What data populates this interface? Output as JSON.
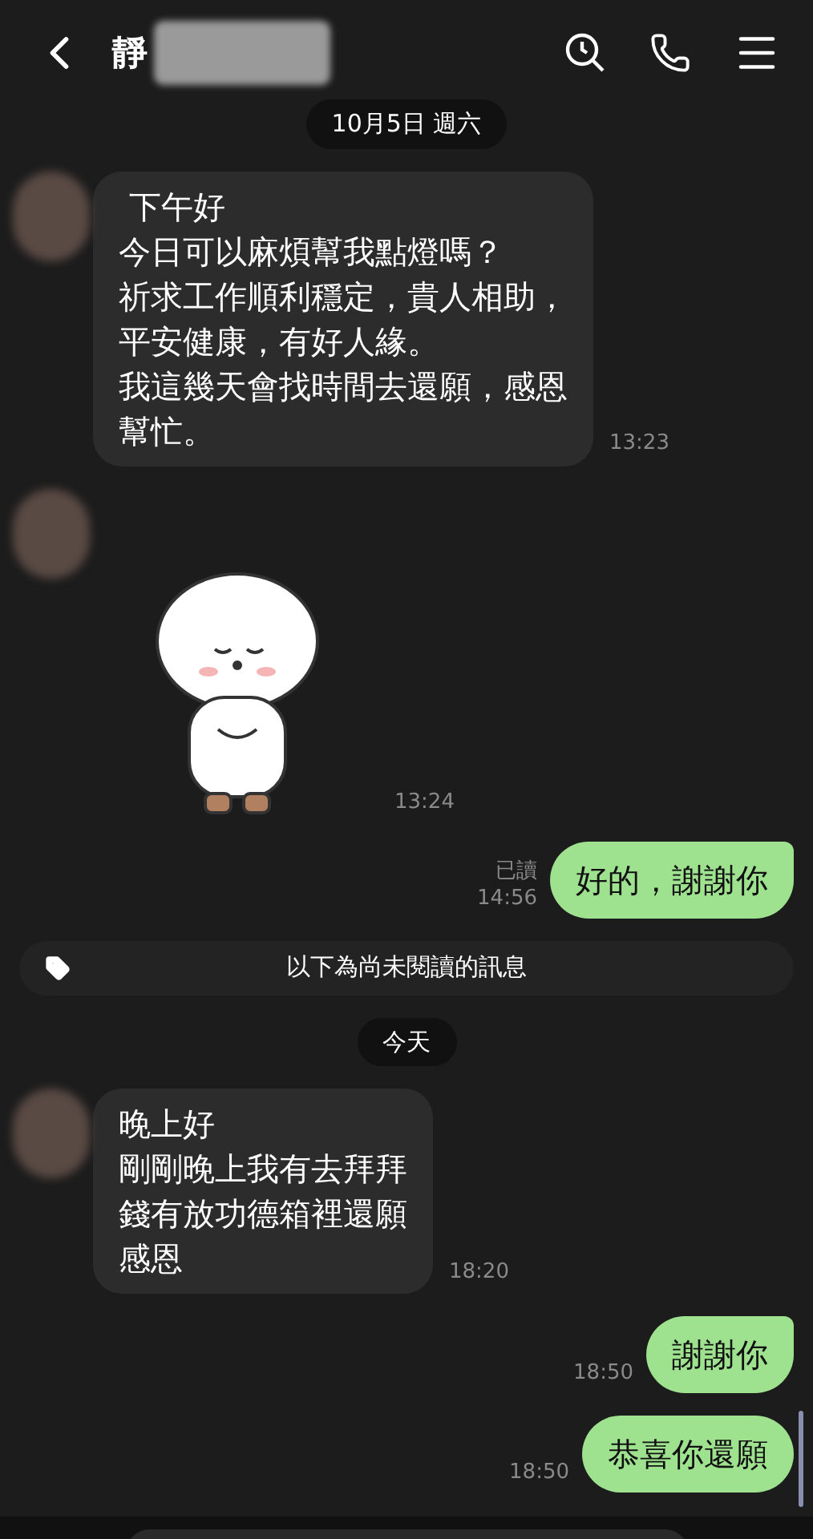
{
  "header": {
    "title": "靜",
    "name_redacted": true
  },
  "messages": [
    {
      "kind": "date",
      "text": "10月5日 週六"
    },
    {
      "kind": "incoming",
      "lines": [
        " 下午好",
        "今日可以麻煩幫我點燈嗎？",
        "祈求工作順利穩定，貴人相助，",
        "平安健康，有好人緣。",
        "我這幾天會找時間去還願，感恩",
        "幫忙。"
      ],
      "time": "13:23"
    },
    {
      "kind": "sticker",
      "time": "13:24"
    },
    {
      "kind": "outgoing",
      "text": "好的，謝謝你",
      "read": "已讀",
      "time": "14:56",
      "tail": true
    },
    {
      "kind": "unread",
      "text": "以下為尚未閱讀的訊息"
    },
    {
      "kind": "date",
      "text": "今天"
    },
    {
      "kind": "incoming",
      "lines": [
        "晚上好",
        "剛剛晚上我有去拜拜",
        "錢有放功德箱裡還願",
        "感恩"
      ],
      "time": "18:20"
    },
    {
      "kind": "outgoing",
      "text": "謝謝你",
      "time": "18:50",
      "tail": true
    },
    {
      "kind": "outgoing",
      "text": "恭喜你還願",
      "time": "18:50",
      "tail": false
    }
  ]
}
